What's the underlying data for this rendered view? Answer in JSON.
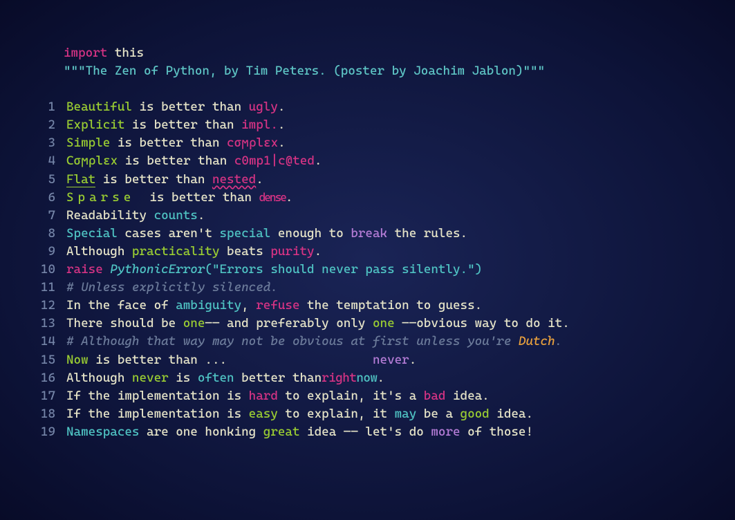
{
  "header": {
    "import_kw": "import",
    "import_mod": "this",
    "docstring_open": "\"\"\"",
    "docstring_text": "The Zen of Python, by Tim Peters. (poster by Joachim Jablon)",
    "docstring_close": "\"\"\""
  },
  "lines": {
    "l1": {
      "n": "1",
      "a": "Beautiful",
      "mid": " is better than ",
      "b": "ugly",
      "end": "."
    },
    "l2": {
      "n": "2",
      "a": "Explicit",
      "mid": " is better than ",
      "b": "impl.",
      "end": "."
    },
    "l3": {
      "n": "3",
      "a": "Simple",
      "mid": " is better than ",
      "b": "cσϻρlεx",
      "end": "."
    },
    "l4": {
      "n": "4",
      "a": "Cσϻρlεx",
      "mid": " is better than ",
      "b": "c0mp1|c@ted",
      "end": "."
    },
    "l5": {
      "n": "5",
      "a": "Flat",
      "mid": " is better than ",
      "b": "nested",
      "end": "."
    },
    "l6": {
      "n": "6",
      "a": "Sparse",
      "mid": "  is better than ",
      "b": "dense",
      "end": "."
    },
    "l7": {
      "n": "7",
      "a": "Readability ",
      "b": "counts",
      "end": "."
    },
    "l8": {
      "n": "8",
      "a": "Special",
      "t1": " cases aren't ",
      "b": "special",
      "t2": " enough to ",
      "c": "break",
      "t3": " the rules."
    },
    "l9": {
      "n": "9",
      "t1": "Although ",
      "a": "practicality",
      "t2": " beats ",
      "b": "purity",
      "end": "."
    },
    "l10": {
      "n": "10",
      "kw": "raise",
      "sp": " ",
      "cls": "PythonicError",
      "args": "(\"Errors should never pass silently.\")"
    },
    "l11": {
      "n": "11",
      "text": "# Unless explicitly silenced."
    },
    "l12": {
      "n": "12",
      "t1": "In the face of ",
      "a": "ambiguity",
      "t2": ", ",
      "b": "refuse",
      "t3": " the temptation to guess."
    },
    "l13": {
      "n": "13",
      "t1": "There should be ",
      "a": "one",
      "t2": "—— and preferably only ",
      "b": "one",
      "t3": " ——obvious way to do it."
    },
    "l14": {
      "n": "14",
      "text": "# Although that way may not be obvious at first unless you're ",
      "dutch": "Dutch",
      "end": "."
    },
    "l15": {
      "n": "15",
      "a": "Now",
      "mid": " is better than ...                    ",
      "b": "never",
      "end": "."
    },
    "l16": {
      "n": "16",
      "t1": "Although ",
      "a": "never",
      "t2": " is ",
      "b": "often",
      "t3": " better than",
      "c": "right",
      "d": "now",
      "end": "."
    },
    "l17": {
      "n": "17",
      "t1": "If the implementation is ",
      "a": "hard",
      "t2": " to explain, it's a ",
      "b": "bad",
      "t3": " idea."
    },
    "l18": {
      "n": "18",
      "t1": "If the implementation is ",
      "a": "easy",
      "t2": " to explain, it ",
      "b": "may",
      "t3": " be a ",
      "c": "good",
      "t4": " idea."
    },
    "l19": {
      "n": "19",
      "a": "Namespaces",
      "t1": " are one honking ",
      "b": "great",
      "t2": " idea —— let's do ",
      "c": "more",
      "t3": " of those!"
    }
  }
}
